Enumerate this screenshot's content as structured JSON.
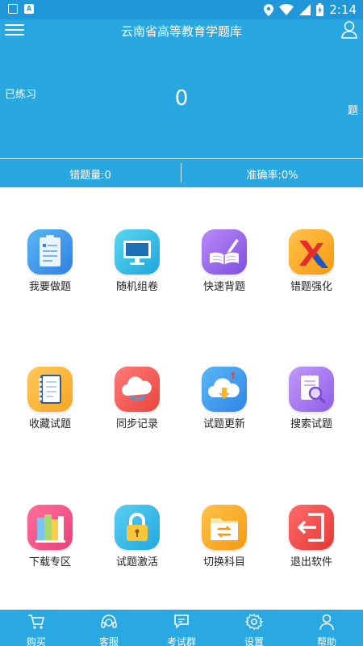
{
  "status_bar": {
    "time": "2:14",
    "icon_a": "A",
    "battery_label": "B"
  },
  "header": {
    "title": "云南省高等教育学题库"
  },
  "stats": {
    "practiced_label": "已练习",
    "practiced_count": "0",
    "practiced_unit": "题",
    "wrong_count": "错题量:0",
    "accuracy": "准确率:0%"
  },
  "menu": [
    {
      "label": "我要做题",
      "icon": "clipboard-icon"
    },
    {
      "label": "随机组卷",
      "icon": "monitor-icon"
    },
    {
      "label": "快速背题",
      "icon": "book-pen-icon"
    },
    {
      "label": "错题强化",
      "icon": "x-mark-icon"
    },
    {
      "label": "收藏试题",
      "icon": "notebook-icon"
    },
    {
      "label": "同步记录",
      "icon": "cloud-sync-icon"
    },
    {
      "label": "试题更新",
      "icon": "cloud-download-icon"
    },
    {
      "label": "搜索试题",
      "icon": "search-doc-icon"
    },
    {
      "label": "下载专区",
      "icon": "books-icon"
    },
    {
      "label": "试题激活",
      "icon": "lock-icon"
    },
    {
      "label": "切换科目",
      "icon": "folder-switch-icon"
    },
    {
      "label": "退出软件",
      "icon": "exit-icon"
    }
  ],
  "bottom_nav": [
    {
      "label": "购买",
      "icon": "cart-icon"
    },
    {
      "label": "客服",
      "icon": "headset-icon"
    },
    {
      "label": "考试群",
      "icon": "chat-icon"
    },
    {
      "label": "设置",
      "icon": "gear-icon"
    },
    {
      "label": "帮助",
      "icon": "person-icon"
    }
  ],
  "colors": {
    "primary": "#29a7e1",
    "statusbar": "#1f97d8"
  }
}
